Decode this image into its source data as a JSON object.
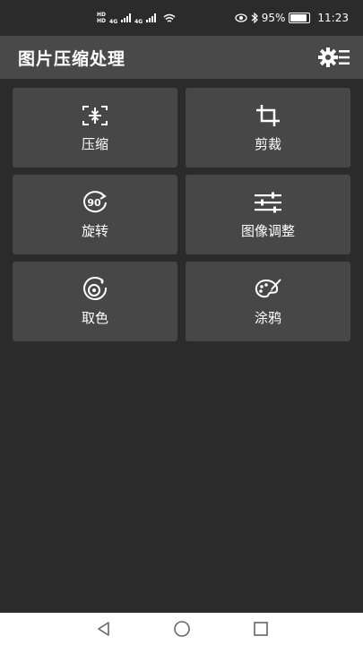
{
  "status_bar": {
    "hd1": "HD",
    "hd2": "HD",
    "net1": "4G",
    "net2": "4G",
    "battery_percent": "95%",
    "battery_level": 95,
    "time": "11:23",
    "icons": [
      "eye-icon",
      "bluetooth-icon",
      "wifi-icon",
      "battery-icon"
    ]
  },
  "app_bar": {
    "title": "图片压缩处理",
    "settings_icon": "gear-menu-icon"
  },
  "tiles": [
    {
      "label": "压缩",
      "icon": "compress-icon"
    },
    {
      "label": "剪裁",
      "icon": "crop-icon"
    },
    {
      "label": "旋转",
      "icon": "rotate-90-icon",
      "icon_text": "90"
    },
    {
      "label": "图像调整",
      "icon": "sliders-icon"
    },
    {
      "label": "取色",
      "icon": "color-picker-icon"
    },
    {
      "label": "涂鸦",
      "icon": "palette-icon"
    }
  ],
  "nav_bar": {
    "icons": [
      "back-icon",
      "home-icon",
      "recents-icon"
    ]
  },
  "colors": {
    "background": "#2b2b2b",
    "app_bar": "#494949",
    "tile": "#474747",
    "text": "#ffffff",
    "nav_bar": "#ffffff"
  }
}
